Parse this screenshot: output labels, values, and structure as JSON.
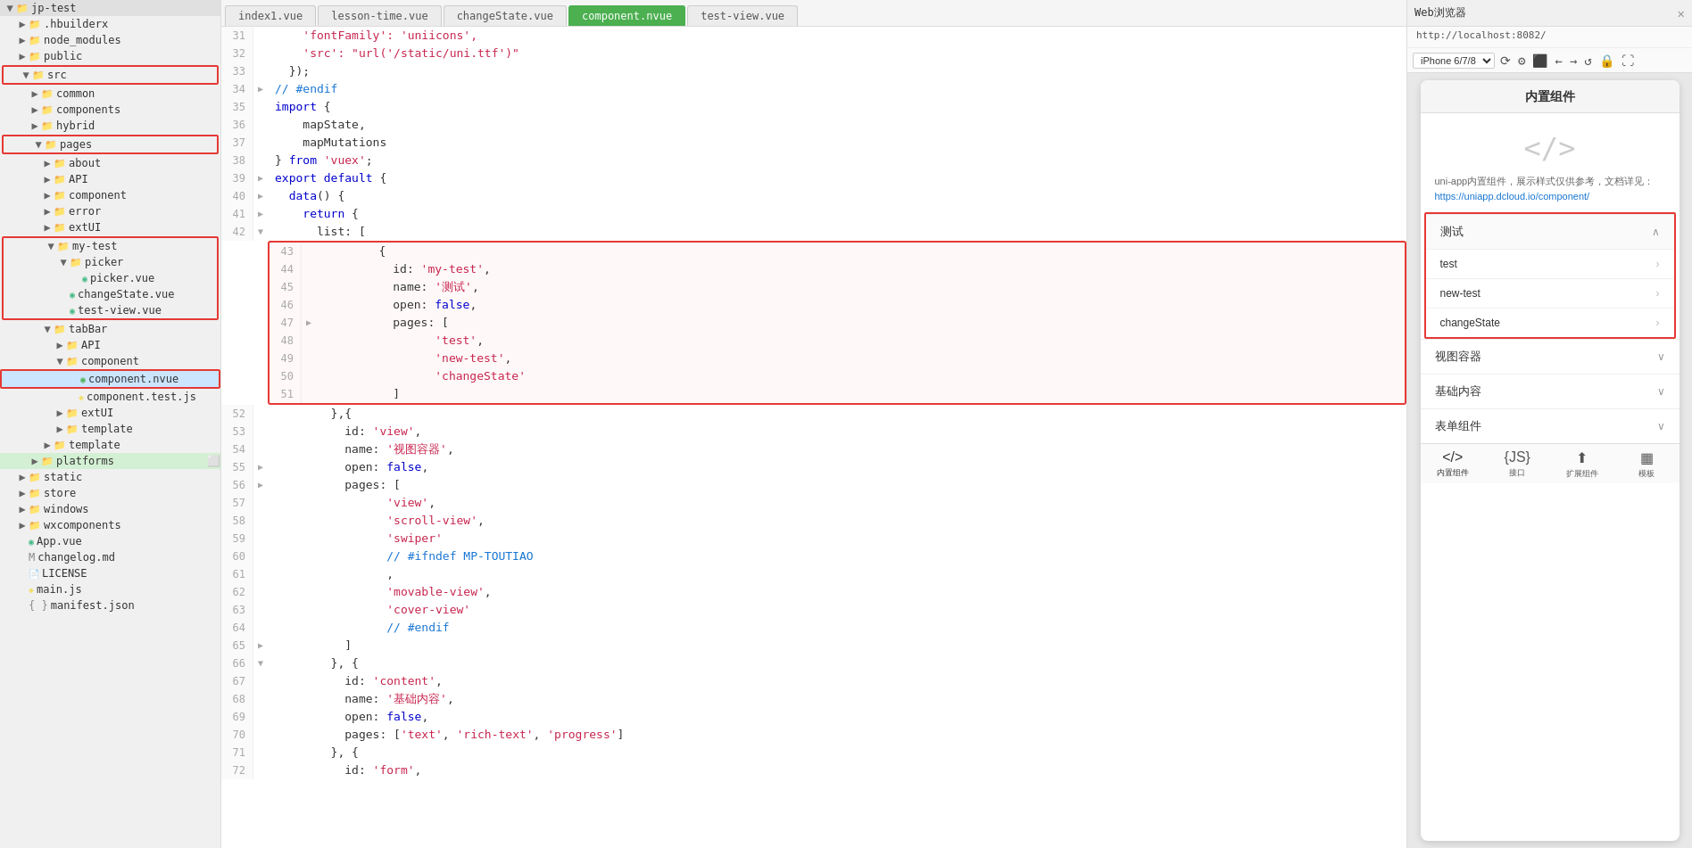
{
  "app": {
    "title": "jp-test"
  },
  "sidebar": {
    "items": [
      {
        "id": "jp-test",
        "label": "jp-test",
        "type": "root",
        "indent": 0,
        "expanded": true,
        "icon": "project"
      },
      {
        "id": "hbuilderx",
        "label": ".hbuilderx",
        "type": "folder",
        "indent": 1,
        "expanded": false,
        "icon": "folder"
      },
      {
        "id": "node_modules",
        "label": "node_modules",
        "type": "folder",
        "indent": 1,
        "expanded": false,
        "icon": "folder"
      },
      {
        "id": "public",
        "label": "public",
        "type": "folder",
        "indent": 1,
        "expanded": false,
        "icon": "folder"
      },
      {
        "id": "src",
        "label": "src",
        "type": "folder",
        "indent": 1,
        "expanded": true,
        "icon": "folder",
        "highlight": true
      },
      {
        "id": "common",
        "label": "common",
        "type": "folder",
        "indent": 2,
        "expanded": false,
        "icon": "folder"
      },
      {
        "id": "components",
        "label": "components",
        "type": "folder",
        "indent": 2,
        "expanded": false,
        "icon": "folder"
      },
      {
        "id": "hybrid",
        "label": "hybrid",
        "type": "folder",
        "indent": 2,
        "expanded": false,
        "icon": "folder"
      },
      {
        "id": "pages",
        "label": "pages",
        "type": "folder",
        "indent": 2,
        "expanded": true,
        "icon": "folder",
        "highlight": true
      },
      {
        "id": "about",
        "label": "about",
        "type": "folder",
        "indent": 3,
        "expanded": false,
        "icon": "folder"
      },
      {
        "id": "API",
        "label": "API",
        "type": "folder",
        "indent": 3,
        "expanded": false,
        "icon": "folder"
      },
      {
        "id": "component",
        "label": "component",
        "type": "folder",
        "indent": 3,
        "expanded": false,
        "icon": "folder"
      },
      {
        "id": "error",
        "label": "error",
        "type": "folder",
        "indent": 3,
        "expanded": false,
        "icon": "folder"
      },
      {
        "id": "extUI",
        "label": "extUI",
        "type": "folder",
        "indent": 3,
        "expanded": false,
        "icon": "folder"
      },
      {
        "id": "my-test",
        "label": "my-test",
        "type": "folder",
        "indent": 3,
        "expanded": true,
        "icon": "folder",
        "highlight": true
      },
      {
        "id": "picker",
        "label": "picker",
        "type": "folder",
        "indent": 4,
        "expanded": true,
        "icon": "folder"
      },
      {
        "id": "picker-vue",
        "label": "picker.vue",
        "type": "vue",
        "indent": 5,
        "icon": "vue"
      },
      {
        "id": "changeState-vue",
        "label": "changeState.vue",
        "type": "vue",
        "indent": 4,
        "icon": "vue"
      },
      {
        "id": "test-view-vue",
        "label": "test-view.vue",
        "type": "vue",
        "indent": 4,
        "icon": "vue"
      },
      {
        "id": "tabBar",
        "label": "tabBar",
        "type": "folder",
        "indent": 3,
        "expanded": true,
        "icon": "folder"
      },
      {
        "id": "tabBar-API",
        "label": "API",
        "type": "folder",
        "indent": 4,
        "expanded": false,
        "icon": "folder"
      },
      {
        "id": "tabBar-component",
        "label": "component",
        "type": "folder",
        "indent": 4,
        "expanded": true,
        "icon": "folder"
      },
      {
        "id": "component-nvue",
        "label": "component.nvue",
        "type": "nvue",
        "indent": 5,
        "icon": "nvue",
        "selected": true
      },
      {
        "id": "component-test-js",
        "label": "component.test.js",
        "type": "js",
        "indent": 5,
        "icon": "js"
      },
      {
        "id": "tabBar-extUI",
        "label": "extUI",
        "type": "folder",
        "indent": 4,
        "expanded": false,
        "icon": "folder"
      },
      {
        "id": "template1",
        "label": "template",
        "type": "folder",
        "indent": 4,
        "expanded": false,
        "icon": "folder"
      },
      {
        "id": "tabBar-template",
        "label": "template",
        "type": "folder",
        "indent": 3,
        "expanded": false,
        "icon": "folder"
      },
      {
        "id": "platforms",
        "label": "platforms",
        "type": "folder",
        "indent": 2,
        "expanded": false,
        "icon": "folder"
      },
      {
        "id": "static",
        "label": "static",
        "type": "folder",
        "indent": 1,
        "expanded": false,
        "icon": "folder"
      },
      {
        "id": "store",
        "label": "store",
        "type": "folder",
        "indent": 1,
        "expanded": false,
        "icon": "folder"
      },
      {
        "id": "windows",
        "label": "windows",
        "type": "folder",
        "indent": 1,
        "expanded": false,
        "icon": "folder"
      },
      {
        "id": "wxcomponents",
        "label": "wxcomponents",
        "type": "folder",
        "indent": 1,
        "expanded": false,
        "icon": "folder"
      },
      {
        "id": "App-vue",
        "label": "App.vue",
        "type": "vue",
        "indent": 1,
        "icon": "vue"
      },
      {
        "id": "changelog-md",
        "label": "changelog.md",
        "type": "md",
        "indent": 1,
        "icon": "md"
      },
      {
        "id": "LICENSE",
        "label": "LICENSE",
        "type": "file",
        "indent": 1,
        "icon": "file"
      },
      {
        "id": "main-js",
        "label": "main.js",
        "type": "js",
        "indent": 1,
        "icon": "js"
      },
      {
        "id": "manifest-json",
        "label": "manifest.json",
        "type": "json",
        "indent": 1,
        "icon": "json"
      }
    ]
  },
  "tabs": [
    {
      "id": "index1-vue",
      "label": "index1.vue",
      "active": false
    },
    {
      "id": "lesson-time-vue",
      "label": "lesson-time.vue",
      "active": false
    },
    {
      "id": "changeState-vue",
      "label": "changeState.vue",
      "active": false
    },
    {
      "id": "component-nvue",
      "label": "component.nvue",
      "active": true
    },
    {
      "id": "test-view-vue",
      "label": "test-view.vue",
      "active": false
    }
  ],
  "code": {
    "lines": [
      {
        "num": 31,
        "content": "    'fontFamily': 'uniicons',",
        "fold": false
      },
      {
        "num": 32,
        "content": "    'src': \"url('/static/uni.ttf')\"",
        "fold": false
      },
      {
        "num": 33,
        "content": "  });",
        "fold": false
      },
      {
        "num": 34,
        "content": "// #endif",
        "fold": true,
        "type": "comment"
      },
      {
        "num": 35,
        "content": "import {",
        "fold": false
      },
      {
        "num": 36,
        "content": "    mapState,",
        "fold": false
      },
      {
        "num": 37,
        "content": "    mapMutations",
        "fold": false
      },
      {
        "num": 38,
        "content": "} from 'vuex';",
        "fold": false
      },
      {
        "num": 39,
        "content": "export default {",
        "fold": true
      },
      {
        "num": 40,
        "content": "  data() {",
        "fold": true
      },
      {
        "num": 41,
        "content": "    return {",
        "fold": true
      },
      {
        "num": 42,
        "content": "      list: [",
        "fold": true
      },
      {
        "num": 43,
        "content": "        {",
        "fold": false
      },
      {
        "num": 44,
        "content": "          id: 'my-test',",
        "fold": false
      },
      {
        "num": 45,
        "content": "          name: '测试',",
        "fold": false
      },
      {
        "num": 46,
        "content": "          open: false,",
        "fold": false
      },
      {
        "num": 47,
        "content": "          pages: [",
        "fold": true
      },
      {
        "num": 48,
        "content": "                'test',",
        "fold": false
      },
      {
        "num": 49,
        "content": "                'new-test',",
        "fold": false
      },
      {
        "num": 50,
        "content": "                'changeState'",
        "fold": false
      },
      {
        "num": 51,
        "content": "          ]",
        "fold": false
      },
      {
        "num": 52,
        "content": "        },{",
        "fold": false
      },
      {
        "num": 53,
        "content": "          id: 'view',",
        "fold": false
      },
      {
        "num": 54,
        "content": "          name: '视图容器',",
        "fold": false
      },
      {
        "num": 55,
        "content": "          open: false,",
        "fold": false
      },
      {
        "num": 56,
        "content": "          pages: [",
        "fold": true
      },
      {
        "num": 57,
        "content": "                'view',",
        "fold": false
      },
      {
        "num": 58,
        "content": "                'scroll-view',",
        "fold": false
      },
      {
        "num": 59,
        "content": "                'swiper'",
        "fold": false
      },
      {
        "num": 60,
        "content": "                // #ifndef MP-TOUTIAO",
        "fold": false,
        "type": "comment"
      },
      {
        "num": 61,
        "content": "                ,",
        "fold": false
      },
      {
        "num": 62,
        "content": "                'movable-view',",
        "fold": false
      },
      {
        "num": 63,
        "content": "                'cover-view'",
        "fold": false
      },
      {
        "num": 64,
        "content": "                // #endif",
        "fold": false,
        "type": "comment"
      },
      {
        "num": 65,
        "content": "          ]",
        "fold": false
      },
      {
        "num": 66,
        "content": "        }, {",
        "fold": true
      },
      {
        "num": 67,
        "content": "          id: 'content',",
        "fold": false
      },
      {
        "num": 68,
        "content": "          name: '基础内容',",
        "fold": false
      },
      {
        "num": 69,
        "content": "          open: false,",
        "fold": false
      },
      {
        "num": 70,
        "content": "          pages: ['text', 'rich-text', 'progress']",
        "fold": false
      },
      {
        "num": 71,
        "content": "        }, {",
        "fold": false
      },
      {
        "num": 72,
        "content": "          id: 'form',",
        "fold": false
      }
    ]
  },
  "browser": {
    "title": "Web浏览器",
    "url": "http://localhost:8082/",
    "device": "iPhone 6/7/8",
    "content": {
      "header": "内置组件",
      "logo": "</>",
      "description": "uni-app内置组件，展示样式仅供参考，文档详见：",
      "link_text": "https://uniapp.dcloud.io/component/",
      "sections": [
        {
          "id": "test-section",
          "label": "测试",
          "expanded": true,
          "items": [
            {
              "label": "test"
            },
            {
              "label": "new-test"
            },
            {
              "label": "changeState"
            }
          ]
        },
        {
          "id": "view-section",
          "label": "视图容器",
          "expanded": false,
          "items": []
        },
        {
          "id": "content-section",
          "label": "基础内容",
          "expanded": false,
          "items": []
        },
        {
          "id": "form-section",
          "label": "表单组件",
          "expanded": false,
          "items": []
        }
      ],
      "bottom_tabs": [
        {
          "id": "builtin",
          "label": "内置组件",
          "icon": "</>",
          "active": true
        },
        {
          "id": "api",
          "label": "接口",
          "icon": "{JS}",
          "active": false
        },
        {
          "id": "extend",
          "label": "扩展组件",
          "icon": "⬆",
          "active": false
        },
        {
          "id": "template",
          "label": "模板",
          "icon": "▦",
          "active": false
        }
      ]
    }
  }
}
